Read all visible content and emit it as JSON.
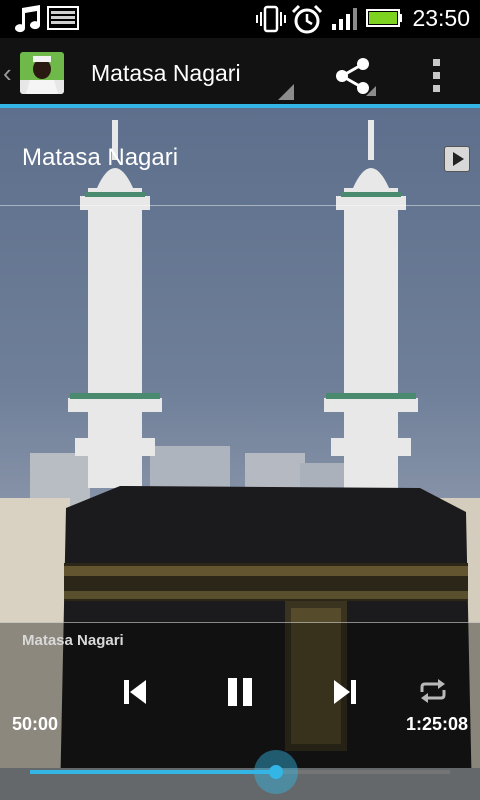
{
  "status_bar": {
    "time": "23:50",
    "icons": [
      "music-note-icon",
      "keyboard-icon",
      "vibrate-icon",
      "alarm-icon",
      "signal-icon",
      "battery-icon"
    ]
  },
  "action_bar": {
    "title": "Matasa Nagari",
    "up_icon": "chevron-left-icon",
    "share_icon": "share-icon",
    "overflow_icon": "overflow-menu-icon",
    "accent_color": "#33b5e5"
  },
  "track_list": [
    {
      "title": "Matasa Nagari",
      "action_icon": "play-icon"
    }
  ],
  "player": {
    "now_playing": "Matasa Nagari",
    "elapsed": "50:00",
    "total": "1:25:08",
    "progress": 0.585,
    "controls": [
      "previous-icon",
      "pause-icon",
      "next-icon",
      "repeat-icon"
    ]
  }
}
